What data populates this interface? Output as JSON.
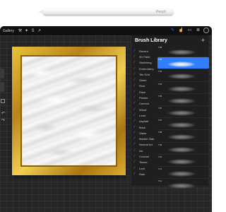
{
  "stylus": {
    "brand_text": "Pencil"
  },
  "toolbar": {
    "gallery_label": "Gallery",
    "left_icons": [
      "wrench-icon",
      "magic-wand-icon",
      "selection-icon",
      "transform-arrow-icon"
    ],
    "right_icons": [
      "brush-icon",
      "smudge-icon",
      "eraser-icon",
      "layers-icon",
      "color-icon"
    ],
    "accent_color": "#2f7fff"
  },
  "brush_library": {
    "title": "Brush Library",
    "add_label": "+",
    "sets": [
      {
        "label": "Recent",
        "selected": false
      },
      {
        "label": "3D Paint",
        "selected": false
      },
      {
        "label": "Sketching",
        "selected": false
      },
      {
        "label": "Embroidery",
        "selected": false
      },
      {
        "label": "Tile Grid",
        "selected": false
      },
      {
        "label": "Stone",
        "selected": false
      },
      {
        "label": "Rust",
        "selected": false
      },
      {
        "label": "Flare",
        "selected": false
      },
      {
        "label": "Plaster",
        "selected": false
      },
      {
        "label": "Cement",
        "selected": false
      },
      {
        "label": "Wood",
        "selected": false
      },
      {
        "label": "Lead",
        "selected": false
      },
      {
        "label": "Asphalt",
        "selected": false
      },
      {
        "label": "Brick",
        "selected": false
      },
      {
        "label": "Glass",
        "selected": false
      },
      {
        "label": "Marble Slab",
        "selected": false
      },
      {
        "label": "Neutral Art",
        "selected": false
      },
      {
        "label": "Ink",
        "selected": false
      },
      {
        "label": "Crochet",
        "selected": false
      },
      {
        "label": "Tissue",
        "selected": false
      },
      {
        "label": "Leaf",
        "selected": false
      },
      {
        "label": "Rain",
        "selected": false
      }
    ],
    "brushes": [
      {
        "name": "T08",
        "selected": false
      },
      {
        "name": "T02",
        "selected": true
      },
      {
        "name": "T03",
        "selected": false
      },
      {
        "name": "T04",
        "selected": false
      },
      {
        "name": "T05",
        "selected": false
      },
      {
        "name": "T06",
        "selected": false
      },
      {
        "name": "T07",
        "selected": false
      },
      {
        "name": "T08",
        "selected": false
      },
      {
        "name": "T09",
        "selected": false
      },
      {
        "name": "T10",
        "selected": false
      },
      {
        "name": "T11",
        "selected": false
      },
      {
        "name": "T12",
        "selected": false
      }
    ]
  }
}
